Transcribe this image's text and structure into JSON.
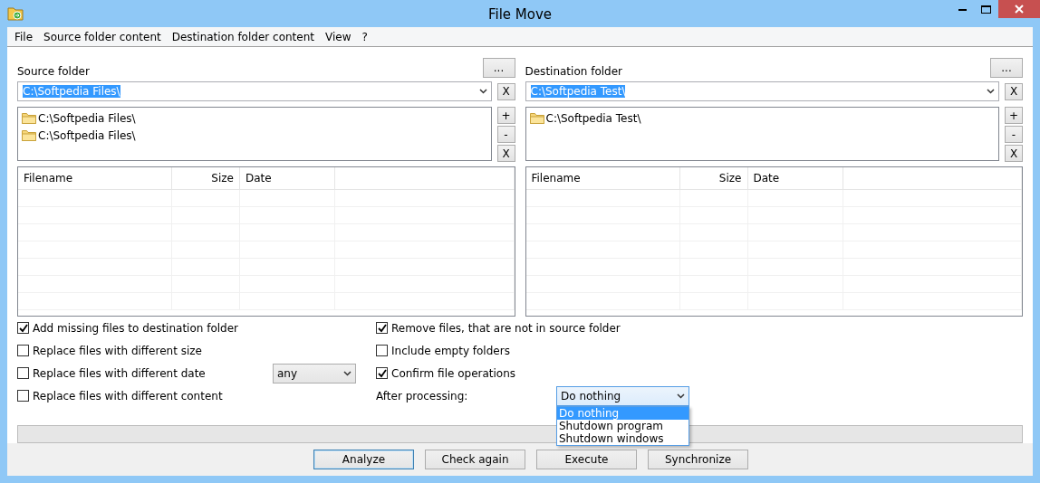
{
  "window": {
    "title": "File Move"
  },
  "menu": [
    "File",
    "Source folder content",
    "Destination folder content",
    "View",
    "?"
  ],
  "panels": [
    {
      "label": "Source folder",
      "browse": "...",
      "path": "C:\\Softpedia Files\\",
      "clear": "X",
      "folders": [
        "C:\\Softpedia Files\\",
        "C:\\Softpedia Files\\"
      ],
      "list_buttons": [
        "+",
        "-",
        "X"
      ],
      "columns": [
        "Filename",
        "Size",
        "Date"
      ]
    },
    {
      "label": "Destination folder",
      "browse": "...",
      "path": "C:\\Softpedia Test\\",
      "clear": "X",
      "folders": [
        "C:\\Softpedia Test\\"
      ],
      "list_buttons": [
        "+",
        "-",
        "X"
      ],
      "columns": [
        "Filename",
        "Size",
        "Date"
      ]
    }
  ],
  "options_left": [
    {
      "label": "Add missing files to destination folder",
      "checked": true
    },
    {
      "label": "Replace files with different size",
      "checked": false
    },
    {
      "label": "Replace files with different date",
      "checked": false
    },
    {
      "label": "Replace files with different content",
      "checked": false
    }
  ],
  "date_filter": {
    "value": "any"
  },
  "options_right": [
    {
      "label": "Remove files, that are not in source folder",
      "checked": true
    },
    {
      "label": "Include empty folders",
      "checked": false
    },
    {
      "label": "Confirm file operations",
      "checked": true
    }
  ],
  "after_processing": {
    "label": "After processing:",
    "value": "Do nothing",
    "expanded": true,
    "options": [
      {
        "label": "Do nothing",
        "selected": true
      },
      {
        "label": "Shutdown program",
        "selected": false
      },
      {
        "label": "Shutdown windows",
        "selected": false
      }
    ]
  },
  "progress": {
    "level": 0
  },
  "buttons": [
    {
      "label": "Analyze",
      "default": true
    },
    {
      "label": "Check again",
      "default": false
    },
    {
      "label": "Execute",
      "default": false
    },
    {
      "label": "Synchronize",
      "default": false
    }
  ]
}
